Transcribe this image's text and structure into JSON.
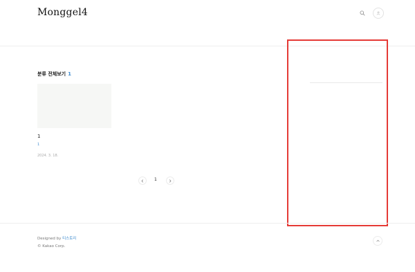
{
  "header": {
    "site_title": "Monggel4",
    "search_icon": "search-icon",
    "profile_icon": "profile-icon"
  },
  "main": {
    "category_title": "분류 전체보기",
    "category_count": "1",
    "posts": [
      {
        "title": "1",
        "excerpt": "1",
        "date": "2024. 3. 18."
      }
    ],
    "pagination": {
      "current_page": "1",
      "prev_icon": "chevron-left-icon",
      "next_icon": "chevron-right-icon"
    }
  },
  "footer": {
    "designed_prefix": "Designed by ",
    "designed_brand": "티스토리",
    "copyright": "© Kakao Corp.",
    "top_icon": "chevron-up-icon"
  },
  "colors": {
    "accent": "#3f8ccf",
    "highlight": "#e53935"
  }
}
